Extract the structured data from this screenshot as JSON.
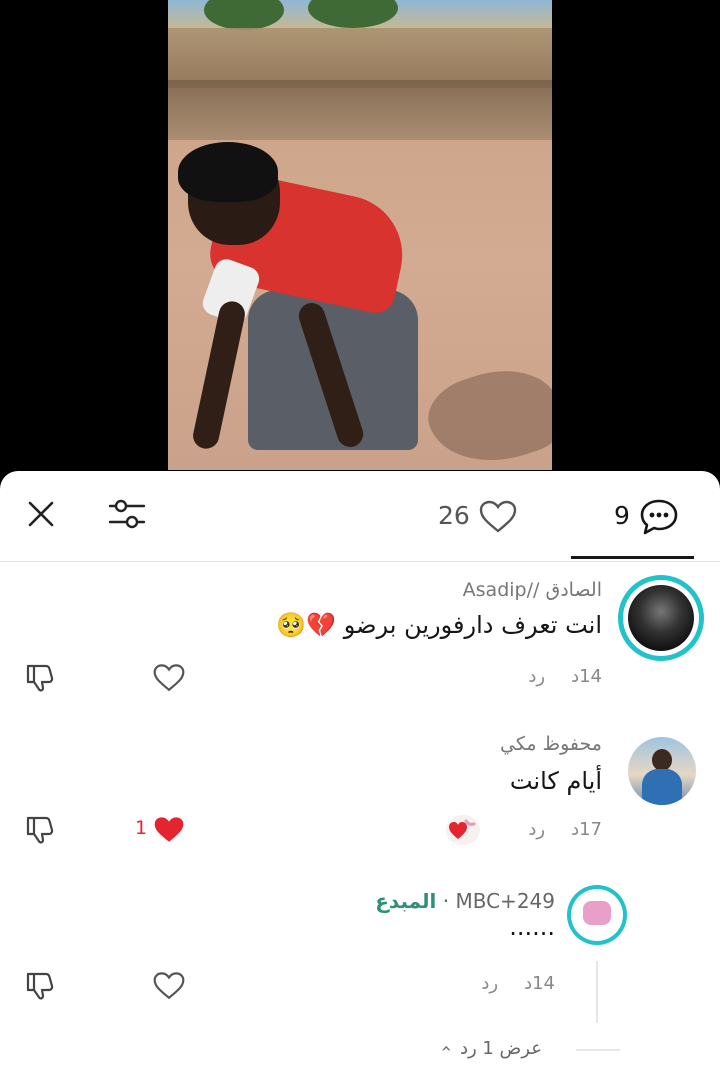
{
  "video": {
    "description": ""
  },
  "toolbar": {
    "close_icon": "close-icon",
    "filter_icon": "sliders-icon",
    "likes_count": "26",
    "comments_count": "9"
  },
  "comments": [
    {
      "name": "الصادق //Asadip",
      "text": "انت تعرف دارفورين برضو 💔🥺",
      "time": "14د",
      "reply_label": "رد"
    },
    {
      "name": "محفوظ مكي",
      "text": "أيام كانت",
      "time": "17د",
      "reply_label": "رد",
      "like_count": "1"
    },
    {
      "name": "MBC+249",
      "creator_label": "المبدع",
      "text": "......",
      "time": "14د",
      "reply_label": "رد",
      "view_replies": "عرض 1 رد"
    }
  ],
  "colors": {
    "accent_red": "#e4242e",
    "creator_green": "#2f8f7a",
    "ring_teal": "#21c2c9"
  }
}
